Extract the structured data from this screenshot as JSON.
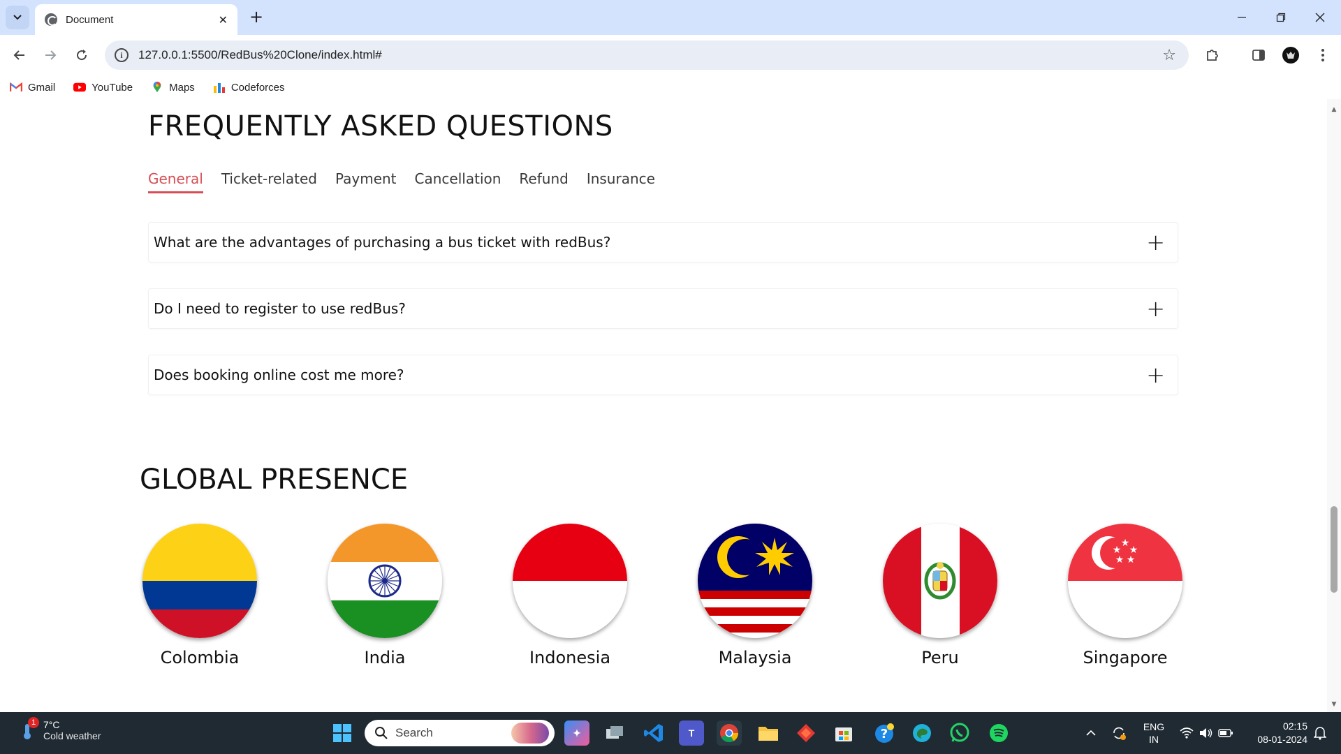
{
  "browser": {
    "tab_title": "Document",
    "url": "127.0.0.1:5500/RedBus%20Clone/index.html#",
    "bookmarks": [
      {
        "label": "Gmail",
        "icon": "gmail-icon"
      },
      {
        "label": "YouTube",
        "icon": "youtube-icon"
      },
      {
        "label": "Maps",
        "icon": "maps-icon"
      },
      {
        "label": "Codeforces",
        "icon": "codeforces-icon"
      }
    ]
  },
  "faq": {
    "title": "FREQUENTLY ASKED QUESTIONS",
    "tabs": [
      "General",
      "Ticket-related",
      "Payment",
      "Cancellation",
      "Refund",
      "Insurance"
    ],
    "active_tab": "General",
    "questions": [
      "What are the advantages of purchasing a bus ticket with redBus?",
      "Do I need to register to use redBus?",
      "Does booking online cost me more?"
    ],
    "expand_symbol": "+"
  },
  "global_presence": {
    "title": "GLOBAL PRESENCE",
    "countries": [
      "Colombia",
      "India",
      "Indonesia",
      "Malaysia",
      "Peru",
      "Singapore"
    ]
  },
  "taskbar": {
    "weather_temp": "7°C",
    "weather_desc": "Cold weather",
    "weather_badge": "1",
    "search_label": "Search",
    "language_top": "ENG",
    "language_bottom": "IN",
    "time": "02:15",
    "date": "08-01-2024"
  },
  "colors": {
    "accent_red": "#d84e55",
    "tabstrip": "#d3e3fd",
    "taskbar": "#1f2a33"
  }
}
